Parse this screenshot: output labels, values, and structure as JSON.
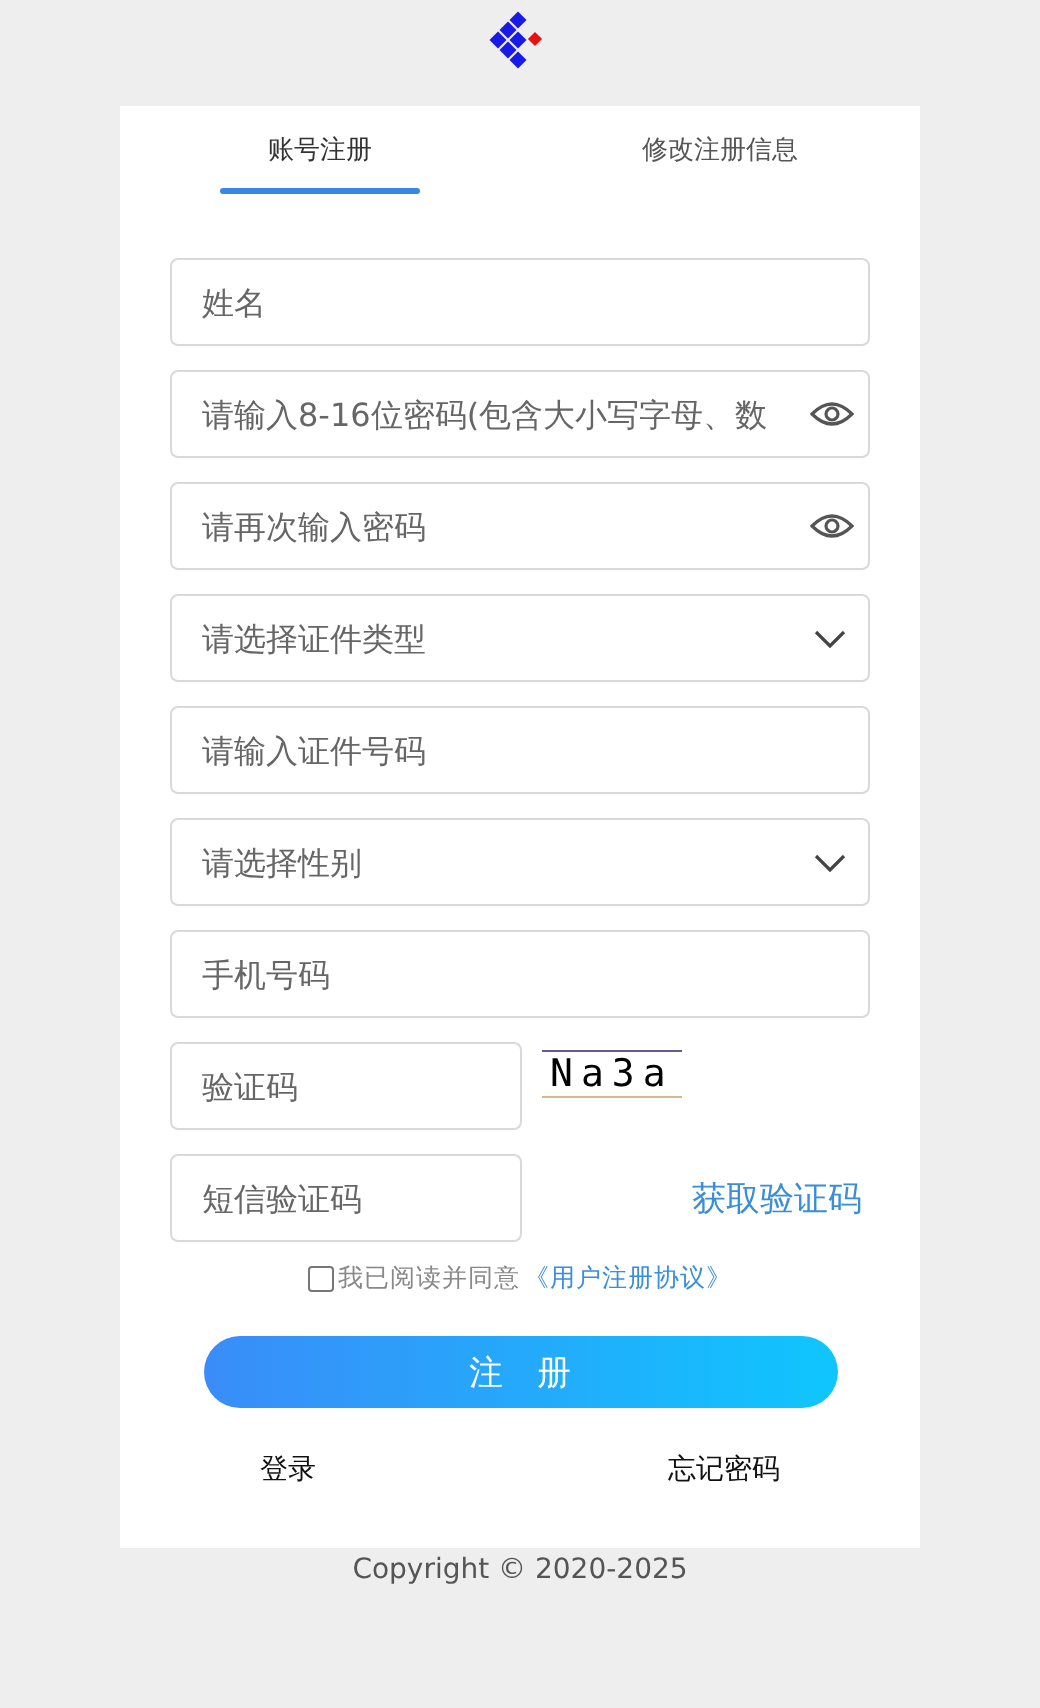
{
  "tabs": [
    {
      "label": "账号注册",
      "selected": true
    },
    {
      "label": "修改注册信息",
      "selected": false
    }
  ],
  "fields": [
    {
      "kind": "text",
      "placeholder": "姓名"
    },
    {
      "kind": "password",
      "placeholder": "请输入8-16位密码(包含大小写字母、数"
    },
    {
      "kind": "password",
      "placeholder": "请再次输入密码"
    },
    {
      "kind": "select",
      "placeholder": "请选择证件类型"
    },
    {
      "kind": "text",
      "placeholder": "请输入证件号码"
    },
    {
      "kind": "select",
      "placeholder": "请选择性别"
    },
    {
      "kind": "text",
      "placeholder": "手机号码"
    }
  ],
  "captcha": {
    "placeholder": "验证码",
    "image_text": "Na3a"
  },
  "sms": {
    "placeholder": "短信验证码",
    "button": "获取验证码"
  },
  "agreement": {
    "checked": false,
    "text": "我已阅读并同意",
    "link": "《用户注册协议》"
  },
  "submit": "注　册",
  "links": [
    "登录",
    "忘记密码"
  ],
  "copyright": "Copyright © 2020-2025"
}
